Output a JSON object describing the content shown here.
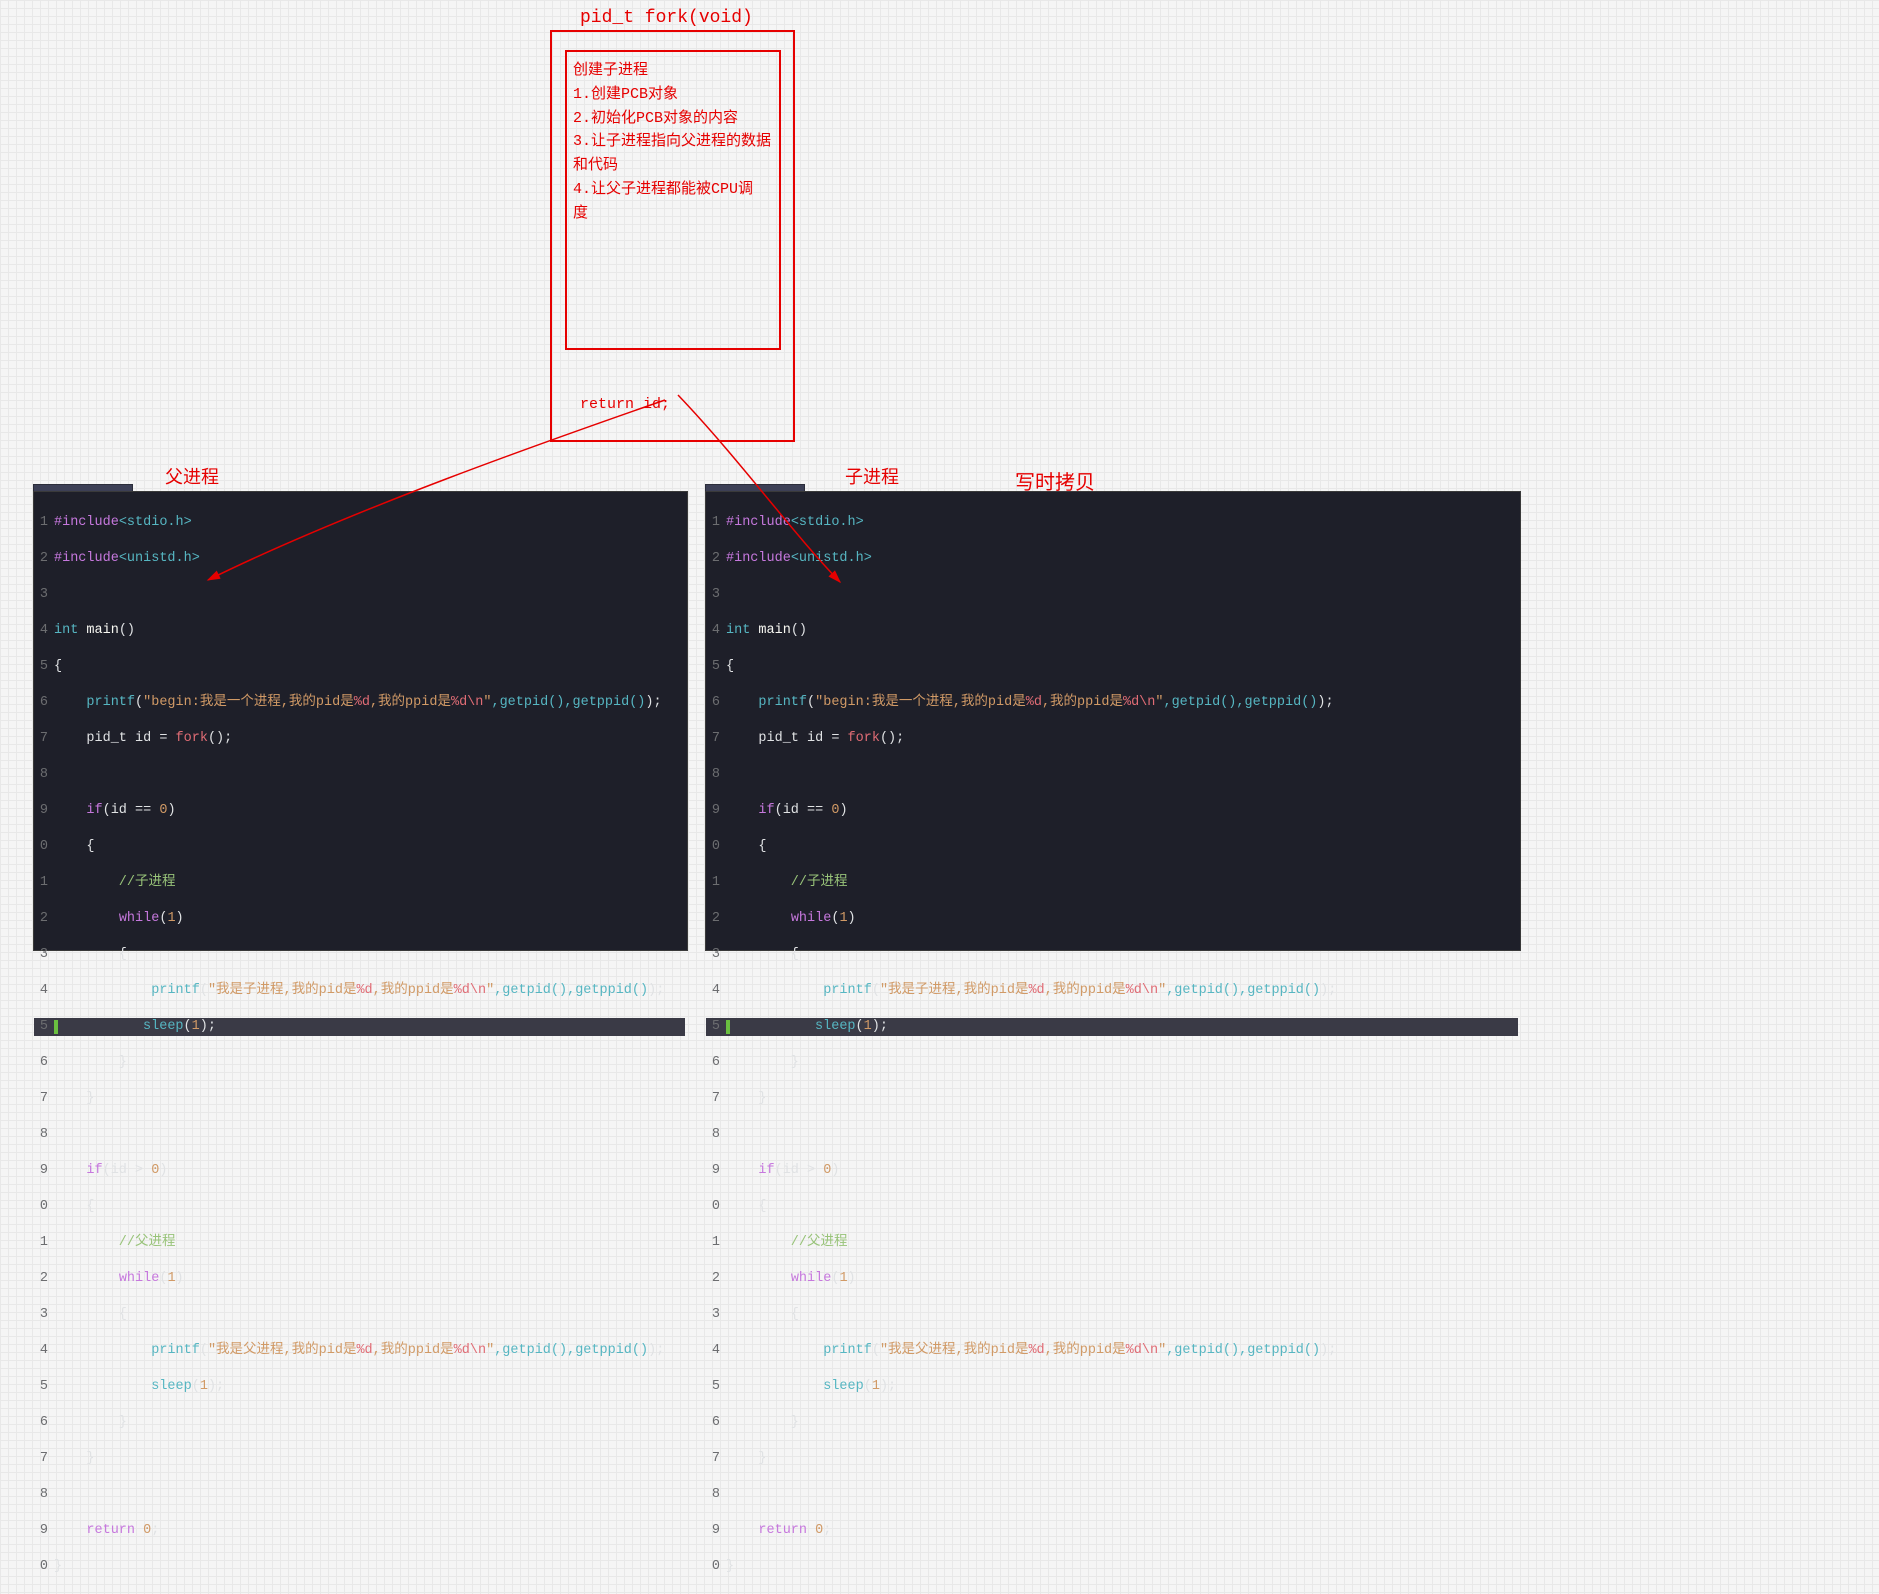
{
  "title": "pid_t fork(void)",
  "fork_box": {
    "l0": "创建子进程",
    "l1": "1.创建PCB对象",
    "l2": "2.初始化PCB对象的内容",
    "l3": "3.让子进程指向父进程的数据",
    "l3b": "和代码",
    "l4": "4.让父子进程都能被CPU调",
    "l4b": "度"
  },
  "return_label": "return id;",
  "labels": {
    "parent": "父进程",
    "child": "子进程",
    "cow": "写时拷贝"
  },
  "code": {
    "include1_kw": "#include",
    "include1_path": "<stdio.h>",
    "include2_kw": "#include",
    "include2_path": "<unistd.h>",
    "main_sig": "int main()",
    "brace_open": "{",
    "brace_close": "}",
    "beg_printf_open": "    printf(\"begin:",
    "beg_str_a": "我是一个进程,我的pid是",
    "pct_d": "%d",
    "beg_str_b": ",我的ppid是",
    "nl_esc": "\\n",
    "getpid_calls": ",getpid(),getppid());",
    "pid_decl_a": "    pid_t id = ",
    "fork_call": "fork",
    "pid_decl_b": "();",
    "if0": "    if(id == 0)",
    "brace2o": "    {",
    "cmt_child": "        //子进程",
    "while1": "        while(1)",
    "brace3o": "        {",
    "child_printf": "            printf(\"我是子进程,我的pid是",
    "sleep1": "            sleep(1);",
    "brace3c": "        }",
    "brace2c": "    }",
    "ifgt0": "    if(id > 0)",
    "cmt_parent": "        //父进程",
    "parent_printf": "            printf(\"我是父进程,我的pid是",
    "return0": "    return 0;",
    "str_close_q": "\"",
    "sleep_word": "sleep",
    "printf_word": "printf",
    "num1": "1"
  }
}
